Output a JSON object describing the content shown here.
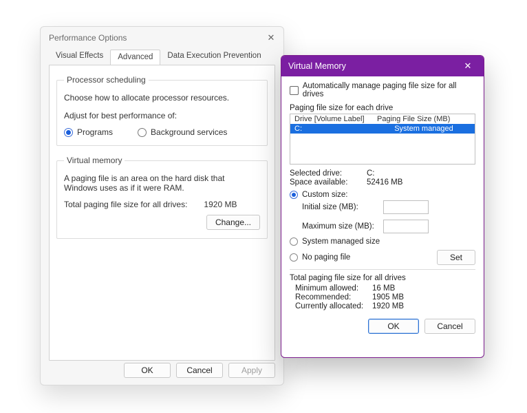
{
  "perf": {
    "title": "Performance Options",
    "tabs": [
      "Visual Effects",
      "Advanced",
      "Data Execution Prevention"
    ],
    "active_tab": 1,
    "sched": {
      "legend": "Processor scheduling",
      "desc": "Choose how to allocate processor resources.",
      "adjust_label": "Adjust for best performance of:",
      "programs": "Programs",
      "background": "Background services",
      "selected": "programs"
    },
    "vm": {
      "legend": "Virtual memory",
      "desc": "A paging file is an area on the hard disk that Windows uses as if it were RAM.",
      "total_label": "Total paging file size for all drives:",
      "total_value": "1920 MB",
      "change_btn": "Change..."
    },
    "footer": {
      "ok": "OK",
      "cancel": "Cancel",
      "apply": "Apply"
    }
  },
  "vmdlg": {
    "title": "Virtual Memory",
    "auto_label": "Automatically manage paging file size for all drives",
    "auto_checked": false,
    "each_drive_label": "Paging file size for each drive",
    "hdr_drive": "Drive  [Volume Label]",
    "hdr_size": "Paging File Size (MB)",
    "drives": [
      {
        "label": "C:",
        "size": "System managed",
        "selected": true
      }
    ],
    "selected_drive_label": "Selected drive:",
    "selected_drive_value": "C:",
    "space_label": "Space available:",
    "space_value": "52416 MB",
    "mode": "custom",
    "custom_label": "Custom size:",
    "initial_label": "Initial size (MB):",
    "initial_value": "",
    "max_label": "Maximum size (MB):",
    "max_value": "",
    "sysmanaged_label": "System managed size",
    "nopaging_label": "No paging file",
    "set_btn": "Set",
    "totals_title": "Total paging file size for all drives",
    "min_label": "Minimum allowed:",
    "min_value": "16 MB",
    "rec_label": "Recommended:",
    "rec_value": "1905 MB",
    "cur_label": "Currently allocated:",
    "cur_value": "1920 MB",
    "ok": "OK",
    "cancel": "Cancel"
  }
}
